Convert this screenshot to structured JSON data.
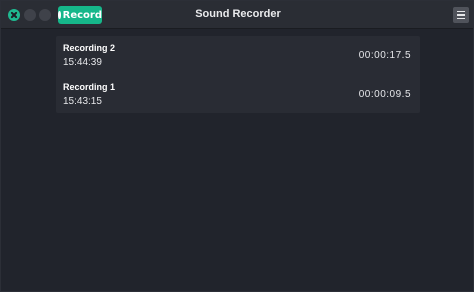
{
  "window": {
    "title": "Sound Recorder"
  },
  "toolbar": {
    "record_label": "Record"
  },
  "recordings": [
    {
      "name": "Recording 2",
      "time": "15:44:39",
      "duration": "00:00:17.5"
    },
    {
      "name": "Recording 1",
      "time": "15:43:15",
      "duration": "00:00:09.5"
    }
  ],
  "colors": {
    "accent": "#16b78a",
    "background": "#21242c",
    "titlebar": "#2a2d34",
    "list_background": "#292c34"
  },
  "icons": {
    "close": "close-icon",
    "minimize": "minimize-icon",
    "maximize": "maximize-icon",
    "record": "record-dot-icon",
    "menu": "hamburger-menu-icon"
  }
}
